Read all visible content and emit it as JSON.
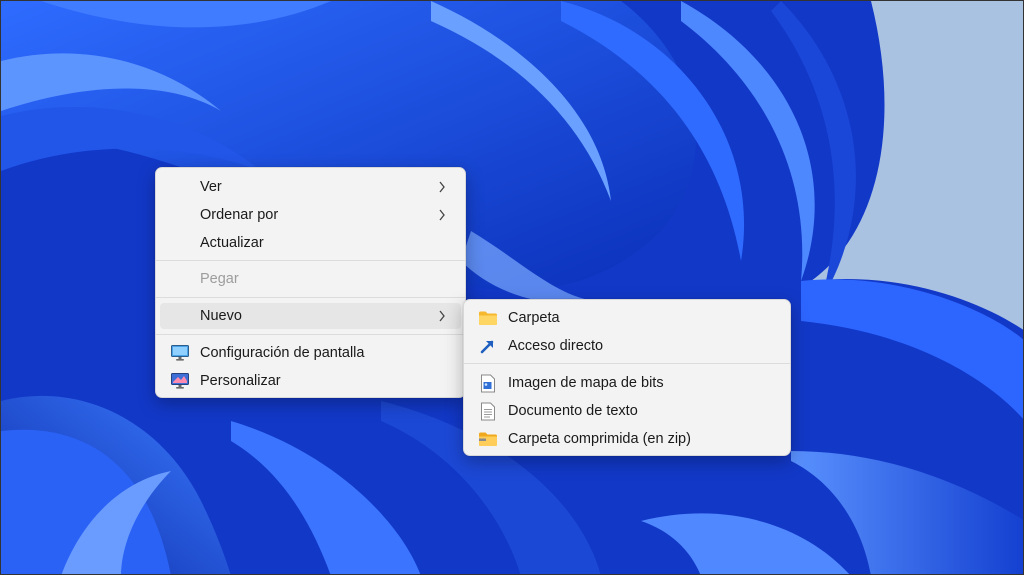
{
  "main_menu": {
    "items": [
      {
        "label": "Ver",
        "has_submenu": true
      },
      {
        "label": "Ordenar por",
        "has_submenu": true
      },
      {
        "label": "Actualizar"
      },
      {
        "label": "Pegar",
        "disabled": true
      },
      {
        "label": "Nuevo",
        "has_submenu": true,
        "highlighted": true
      },
      {
        "label": "Configuración de pantalla",
        "icon": "display-settings-icon"
      },
      {
        "label": "Personalizar",
        "icon": "personalize-icon"
      }
    ]
  },
  "submenu_nuevo": {
    "items": [
      {
        "label": "Carpeta",
        "icon": "folder-icon"
      },
      {
        "label": "Acceso directo",
        "icon": "shortcut-icon"
      },
      {
        "label": "Imagen de mapa de bits",
        "icon": "bitmap-image-icon"
      },
      {
        "label": "Documento de texto",
        "icon": "text-document-icon"
      },
      {
        "label": "Carpeta comprimida (en zip)",
        "icon": "zip-folder-icon"
      }
    ]
  },
  "colors": {
    "menu_bg": "#f3f3f3",
    "highlight": "#e6e6e6",
    "wallpaper_blue": "#1a4fe0",
    "wallpaper_sky": "#aac2e2",
    "accent": "#0067c0"
  }
}
